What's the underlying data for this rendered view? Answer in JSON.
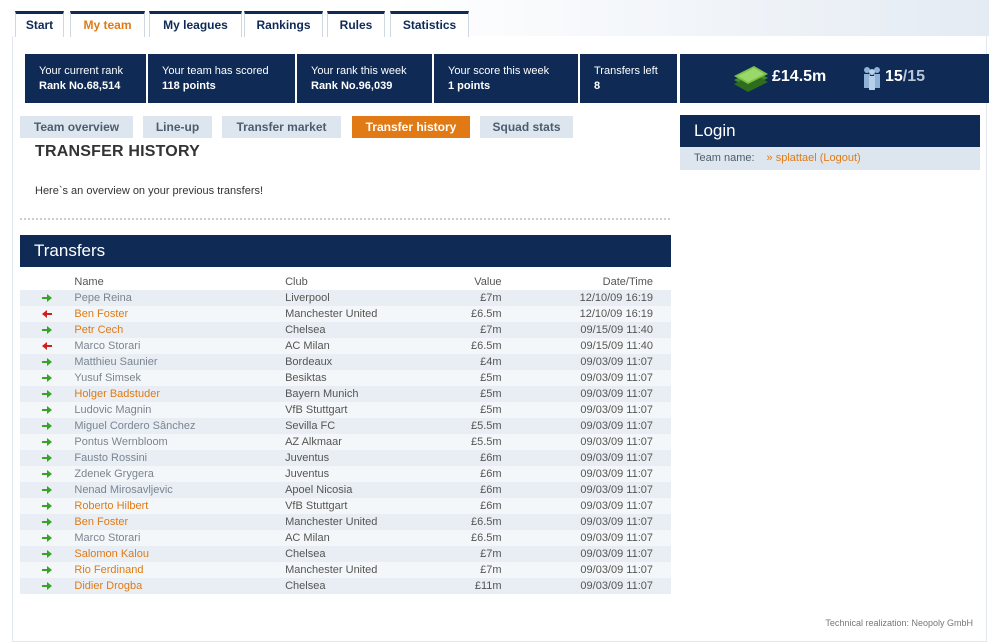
{
  "nav": {
    "tabs": [
      {
        "label": "Start"
      },
      {
        "label": "My team"
      },
      {
        "label": "My leagues"
      },
      {
        "label": "Rankings"
      },
      {
        "label": "Rules"
      },
      {
        "label": "Statistics"
      }
    ],
    "active": "My team"
  },
  "stats": [
    {
      "label": "Your current rank",
      "value": "Rank No.68,514"
    },
    {
      "label": "Your team has scored",
      "value": "118 points"
    },
    {
      "label": "Your rank this week",
      "value": "Rank No.96,039"
    },
    {
      "label": "Your score this week",
      "value": "1 points"
    },
    {
      "label": "Transfers left",
      "value": "8"
    }
  ],
  "budget": "£14.5m",
  "squad": {
    "count": "15",
    "max": "/15"
  },
  "subnav": {
    "items": [
      {
        "label": "Team overview"
      },
      {
        "label": "Line-up"
      },
      {
        "label": "Transfer market"
      },
      {
        "label": "Transfer history"
      },
      {
        "label": "Squad stats"
      }
    ],
    "active": "Transfer history"
  },
  "page": {
    "title": "TRANSFER HISTORY",
    "intro": "Here`s an overview on your previous transfers!"
  },
  "transfers": {
    "heading": "Transfers",
    "columns": {
      "name": "Name",
      "club": "Club",
      "value": "Value",
      "date": "Date/Time"
    },
    "rows": [
      {
        "dir": "in",
        "name": "Pepe Reina",
        "club": "Liverpool",
        "value": "£7m",
        "date": "12/10/09 16:19",
        "link": false
      },
      {
        "dir": "out",
        "name": "Ben Foster",
        "club": "Manchester United",
        "value": "£6.5m",
        "date": "12/10/09 16:19",
        "link": true
      },
      {
        "dir": "in",
        "name": "Petr Cech",
        "club": "Chelsea",
        "value": "£7m",
        "date": "09/15/09 11:40",
        "link": true
      },
      {
        "dir": "out",
        "name": "Marco Storari",
        "club": "AC Milan",
        "value": "£6.5m",
        "date": "09/15/09 11:40",
        "link": false
      },
      {
        "dir": "in",
        "name": "Matthieu Saunier",
        "club": "Bordeaux",
        "value": "£4m",
        "date": "09/03/09 11:07",
        "link": false
      },
      {
        "dir": "in",
        "name": "Yusuf Simsek",
        "club": "Besiktas",
        "value": "£5m",
        "date": "09/03/09 11:07",
        "link": false
      },
      {
        "dir": "in",
        "name": "Holger Badstuder",
        "club": "Bayern Munich",
        "value": "£5m",
        "date": "09/03/09 11:07",
        "link": true
      },
      {
        "dir": "in",
        "name": "Ludovic Magnin",
        "club": "VfB Stuttgart",
        "value": "£5m",
        "date": "09/03/09 11:07",
        "link": false
      },
      {
        "dir": "in",
        "name": "Miguel Cordero Sânchez",
        "club": "Sevilla FC",
        "value": "£5.5m",
        "date": "09/03/09 11:07",
        "link": false
      },
      {
        "dir": "in",
        "name": "Pontus Wernbloom",
        "club": "AZ Alkmaar",
        "value": "£5.5m",
        "date": "09/03/09 11:07",
        "link": false
      },
      {
        "dir": "in",
        "name": "Fausto Rossini",
        "club": "Juventus",
        "value": "£6m",
        "date": "09/03/09 11:07",
        "link": false
      },
      {
        "dir": "in",
        "name": "Zdenek Grygera",
        "club": "Juventus",
        "value": "£6m",
        "date": "09/03/09 11:07",
        "link": false
      },
      {
        "dir": "in",
        "name": "Nenad Mirosavljevic",
        "club": "Apoel Nicosia",
        "value": "£6m",
        "date": "09/03/09 11:07",
        "link": false
      },
      {
        "dir": "in",
        "name": "Roberto Hilbert",
        "club": "VfB Stuttgart",
        "value": "£6m",
        "date": "09/03/09 11:07",
        "link": true
      },
      {
        "dir": "in",
        "name": "Ben Foster",
        "club": "Manchester United",
        "value": "£6.5m",
        "date": "09/03/09 11:07",
        "link": true
      },
      {
        "dir": "in",
        "name": "Marco Storari",
        "club": "AC Milan",
        "value": "£6.5m",
        "date": "09/03/09 11:07",
        "link": false
      },
      {
        "dir": "in",
        "name": "Salomon Kalou",
        "club": "Chelsea",
        "value": "£7m",
        "date": "09/03/09 11:07",
        "link": true
      },
      {
        "dir": "in",
        "name": "Rio Ferdinand",
        "club": "Manchester United",
        "value": "£7m",
        "date": "09/03/09 11:07",
        "link": true
      },
      {
        "dir": "in",
        "name": "Didier Drogba",
        "club": "Chelsea",
        "value": "£11m",
        "date": "09/03/09 11:07",
        "link": true
      }
    ]
  },
  "login": {
    "heading": "Login",
    "team_label": "Team name:",
    "team_value": "» splattael (Logout)"
  },
  "footer": "Technical realization: Neopoly GmbH",
  "colors": {
    "navy": "#0e2a55",
    "orange": "#e17a14",
    "in_arrow": "#3aa324",
    "out_arrow": "#c9231b"
  }
}
